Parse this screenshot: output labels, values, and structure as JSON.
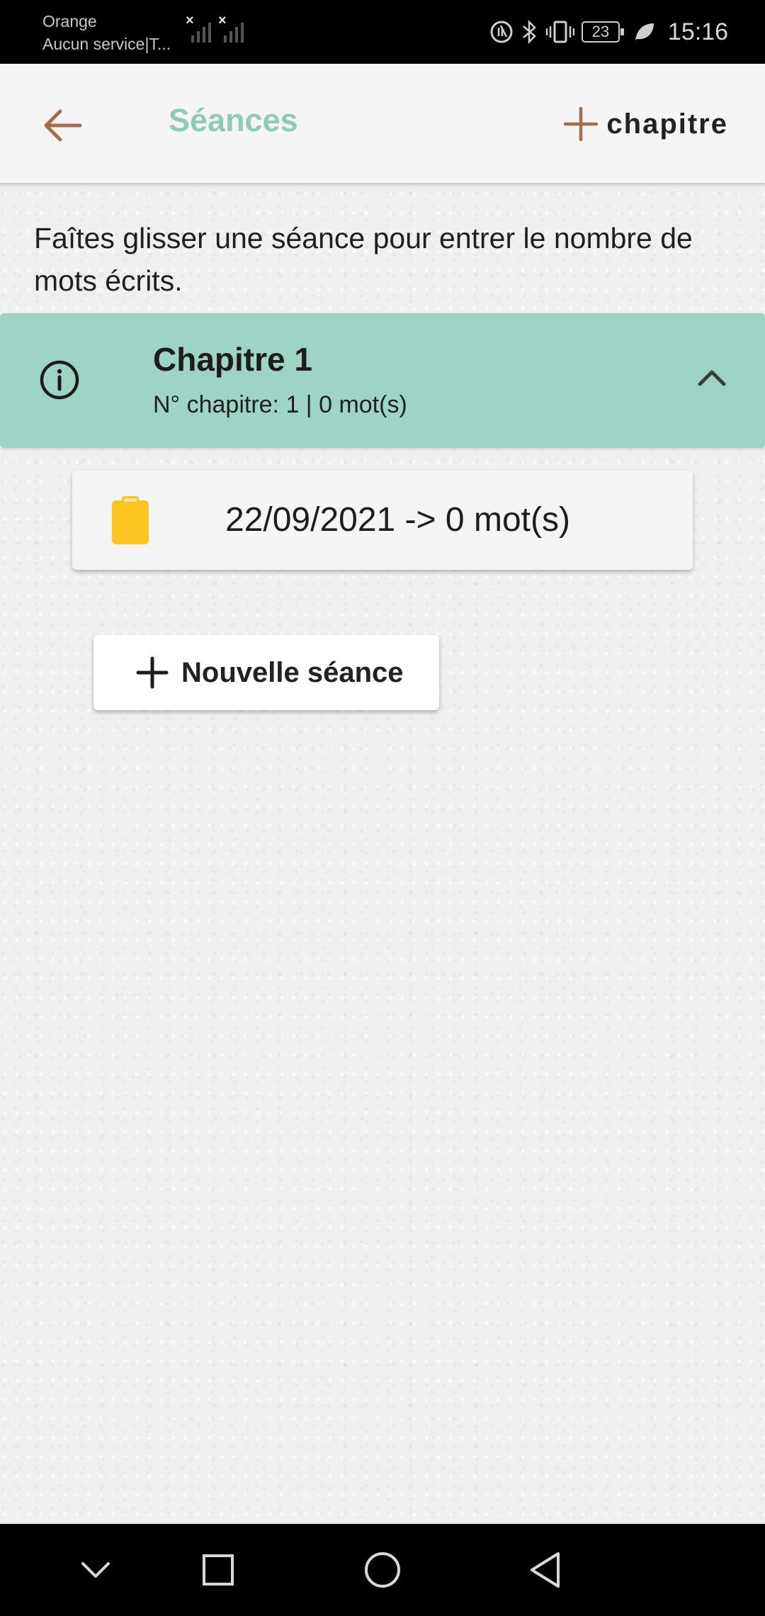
{
  "status_bar": {
    "carrier_line1": "Orange",
    "carrier_line2": "Aucun service|T...",
    "battery": "23",
    "time": "15:16"
  },
  "topbar": {
    "back_icon": "arrow-left-icon",
    "title": "Séances",
    "add_chapter_label": "chapitre",
    "add_icon": "plus-icon"
  },
  "hint": "Faîtes glisser une séance pour entrer le nombre de mots écrits.",
  "chapter": {
    "title": "Chapitre 1",
    "meta": "N° chapitre: 1 | 0 mot(s)",
    "info_icon": "info-icon",
    "collapse_icon": "chevron-up-icon"
  },
  "sessions": [
    {
      "label": "22/09/2021 -> 0 mot(s)",
      "icon": "clipboard-icon"
    }
  ],
  "new_session": {
    "label": "Nouvelle séance"
  },
  "colors": {
    "accent": "#8fcbb8",
    "chapter_bg": "#9dd4c4",
    "back_arrow": "#a26f4c",
    "clipboard": "#fcc420"
  }
}
